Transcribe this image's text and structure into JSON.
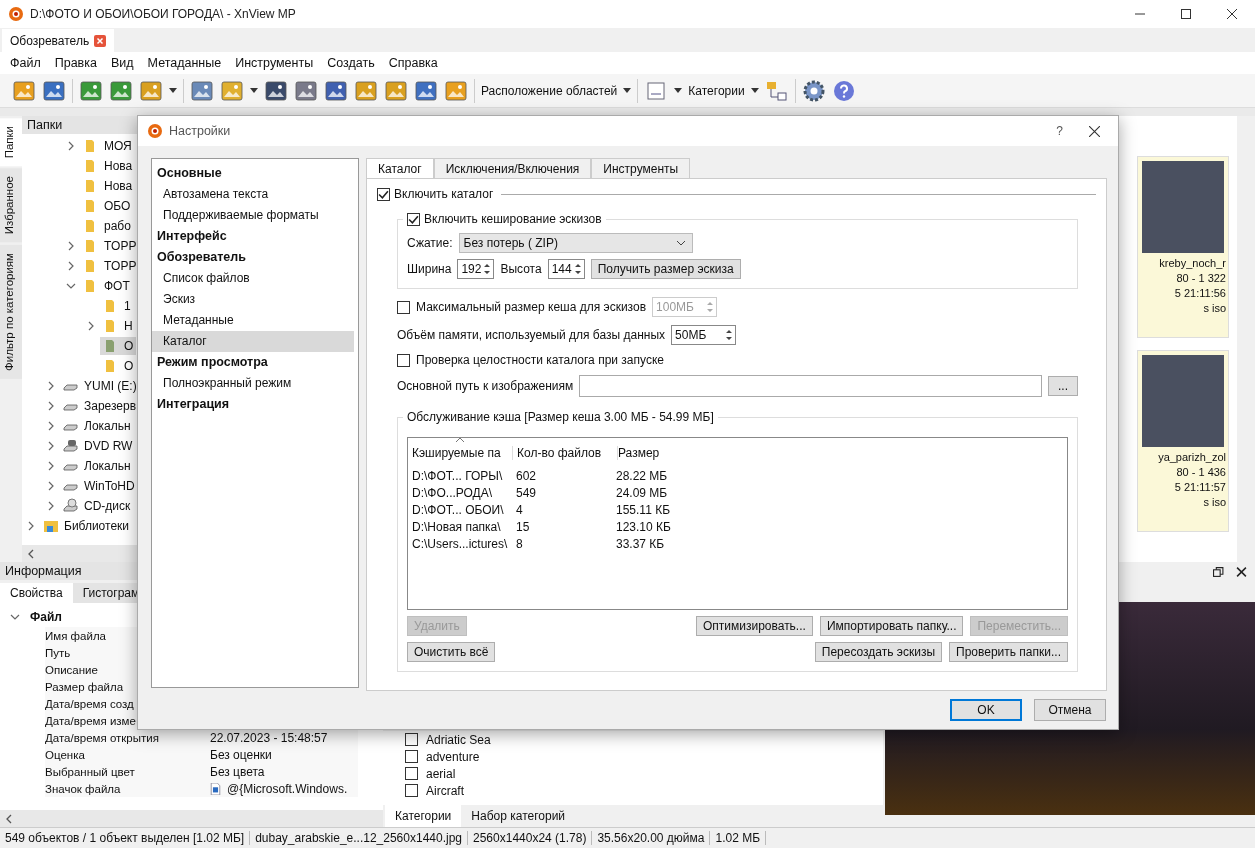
{
  "window": {
    "title": "D:\\ФОТО И ОБОИ\\ОБОИ ГОРОДА\\ - XnView MP"
  },
  "doc_tabs": [
    {
      "label": "Обозреватель",
      "selected": true
    }
  ],
  "menu": [
    "Файл",
    "Правка",
    "Вид",
    "Метаданные",
    "Инструменты",
    "Создать",
    "Справка"
  ],
  "toolbar": {
    "layout_dropdown": "Расположение областей",
    "categories_dropdown": "Категории"
  },
  "side_tabs": [
    {
      "label": "Папки",
      "selected": true
    },
    {
      "label": "Избранное",
      "selected": false
    },
    {
      "label": "Фильтр по категориям",
      "selected": false
    }
  ],
  "folders": {
    "title": "Папки",
    "tree": [
      {
        "children": [
          {
            "children": [
              {
                "label": "МОЯ",
                "kind": "folder",
                "expanded": false,
                "selected": false
              },
              {
                "label": "Нова",
                "kind": "folder",
                "selected": false
              },
              {
                "label": "Нова",
                "kind": "folder",
                "selected": false
              },
              {
                "label": "ОБО",
                "kind": "folder",
                "selected": false
              },
              {
                "label": "рабо",
                "kind": "folder",
                "selected": false
              },
              {
                "label": "TOPP",
                "kind": "folder",
                "expanded": false,
                "selected": false
              },
              {
                "label": "TOPP",
                "kind": "folder",
                "expanded": false,
                "selected": false
              },
              {
                "label": "ФОТ",
                "kind": "folder",
                "expanded": true,
                "selected": false,
                "children": [
                  {
                    "label": "1",
                    "kind": "folder",
                    "selected": false
                  },
                  {
                    "label": "Н",
                    "kind": "folder",
                    "expanded": false,
                    "selected": false
                  },
                  {
                    "label": "О",
                    "kind": "folder",
                    "selected": true
                  },
                  {
                    "label": "О",
                    "kind": "folder",
                    "selected": false
                  }
                ]
              }
            ]
          },
          {
            "label": "YUMI (E:)",
            "kind": "drive",
            "expanded": false,
            "selected": false
          },
          {
            "label": "Зарезерв",
            "kind": "drive",
            "expanded": false,
            "selected": false
          },
          {
            "label": "Локальн",
            "kind": "drive",
            "expanded": false,
            "selected": false
          },
          {
            "label": "DVD RW",
            "kind": "dvd",
            "expanded": false,
            "selected": false
          },
          {
            "label": "Локальн",
            "kind": "drive",
            "expanded": false,
            "selected": false
          },
          {
            "label": "WinToHD",
            "kind": "drive",
            "expanded": false,
            "selected": false
          },
          {
            "label": "CD-диск",
            "kind": "cd",
            "expanded": false,
            "selected": false
          }
        ]
      },
      {
        "label": "Библиотеки",
        "kind": "library",
        "expanded": false,
        "selected": false
      }
    ]
  },
  "thumbnails": [
    {
      "name": "kreby_noch_r",
      "dimensions": "80 - 1 322",
      "date": "5 21:11:56",
      "tag": "s iso"
    },
    {
      "name": "ya_parizh_zol",
      "dimensions": "80 - 1 436",
      "date": "5 21:11:57",
      "tag": "s iso"
    }
  ],
  "info": {
    "title": "Информация",
    "tabs": [
      {
        "label": "Свойства",
        "selected": true
      },
      {
        "label": "Гистограм",
        "selected": false
      }
    ],
    "section": {
      "label": "Файл",
      "expanded": true,
      "rows": [
        {
          "name": "Имя файла"
        },
        {
          "name": "Путь"
        },
        {
          "name": "Описание"
        },
        {
          "name": "Размер файла"
        },
        {
          "name": "Дата/время созд"
        },
        {
          "name": "Дата/время изме"
        },
        {
          "name": "Дата/время открытия",
          "value": "22.07.2023 - 15:48:57"
        },
        {
          "name": "Оценка",
          "value": "Без оценки"
        },
        {
          "name": "Выбранный цвет",
          "value": "Без цвета"
        },
        {
          "name": "Значок файла",
          "value": "@{Microsoft.Windows.",
          "kind": "icon"
        }
      ]
    }
  },
  "categories": {
    "items": [
      {
        "label": "Adriatic Sea",
        "checked": false
      },
      {
        "label": "adventure",
        "checked": false
      },
      {
        "label": "aerial",
        "checked": false
      },
      {
        "label": "Aircraft",
        "checked": false
      }
    ],
    "tabs": [
      {
        "label": "Категории",
        "selected": true
      },
      {
        "label": "Набор категорий",
        "selected": false
      }
    ]
  },
  "status_bar": [
    "549 объектов / 1 объект выделен [1.02 МБ]",
    "dubay_arabskie_e...12_2560x1440.jpg",
    "2560x1440x24 (1.78)",
    "35.56x20.00 дюйма",
    "1.02 МБ"
  ],
  "dialog": {
    "title": "Настройки",
    "help": "?",
    "nav": [
      {
        "label": "Основные",
        "kind": "section",
        "selected": false
      },
      {
        "label": "Автозамена текста",
        "kind": "page",
        "selected": false
      },
      {
        "label": "Поддерживаемые форматы",
        "kind": "page",
        "selected": false
      },
      {
        "label": "Интерфейс",
        "kind": "section",
        "selected": false
      },
      {
        "label": "Обозреватель",
        "kind": "section",
        "selected": false
      },
      {
        "label": "Список файлов",
        "kind": "page",
        "selected": false
      },
      {
        "label": "Эскиз",
        "kind": "page",
        "selected": false
      },
      {
        "label": "Метаданные",
        "kind": "page",
        "selected": false
      },
      {
        "label": "Каталог",
        "kind": "page",
        "selected": true
      },
      {
        "label": "Режим просмотра",
        "kind": "section",
        "selected": false
      },
      {
        "label": "Полноэкранный режим",
        "kind": "page",
        "selected": false
      },
      {
        "label": "Интеграция",
        "kind": "section",
        "selected": false
      }
    ],
    "tabs": [
      {
        "label": "Каталог",
        "selected": true
      },
      {
        "label": "Исключения/Включения",
        "selected": false
      },
      {
        "label": "Инструменты",
        "selected": false
      }
    ],
    "enable_catalog": {
      "label": "Включить каталог",
      "checked": true
    },
    "thumb_cache": {
      "label": "Включить кеширование эскизов",
      "checked": true,
      "compression_label": "Сжатие:",
      "compression_value": "Без потерь ( ZIP)",
      "width_label": "Ширина",
      "width_value": "192",
      "height_label": "Высота",
      "height_value": "144",
      "get_size_button": "Получить размер эскиза"
    },
    "max_cache": {
      "label": "Максимальный размер кеша для эскизов",
      "checked": false,
      "value": "100МБ",
      "disabled": true
    },
    "db_memory": {
      "label": "Объём памяти, используемый для базы данных",
      "value": "50МБ"
    },
    "integrity_check": {
      "label": "Проверка целостности каталога при запуске",
      "checked": false
    },
    "base_path": {
      "label": "Основной путь к изображениям",
      "browse_button": "..."
    },
    "cache_maintenance": {
      "title": "Обслуживание кэша [Размер кеша 3.00 МБ - 54.99 МБ]",
      "columns": [
        "Кэшируемые па",
        "Кол-во файлов",
        "Размер"
      ],
      "rows": [
        [
          "D:\\ФОТ... ГОРЫ\\",
          "602",
          "28.22 МБ"
        ],
        [
          "D:\\ФО...РОДА\\",
          "549",
          "24.09 МБ"
        ],
        [
          "D:\\ФОТ... ОБОИ\\",
          "4",
          "155.11 КБ"
        ],
        [
          "D:\\Новая папка\\",
          "15",
          "123.10 КБ"
        ],
        [
          "C:\\Users...ictures\\",
          "8",
          "33.37 КБ"
        ]
      ],
      "button_rows": [
        {
          "left": [
            {
              "label": "Удалить",
              "disabled": true
            }
          ],
          "right": [
            {
              "label": "Оптимизировать...",
              "disabled": false
            },
            {
              "label": "Импортировать папку...",
              "disabled": false
            },
            {
              "label": "Переместить...",
              "disabled": true
            }
          ]
        },
        {
          "left": [
            {
              "label": "Очистить всё",
              "disabled": false
            }
          ],
          "right": [
            {
              "label": "Пересоздать эскизы",
              "disabled": false
            },
            {
              "label": "Проверить папки...",
              "disabled": false
            }
          ]
        }
      ]
    },
    "buttons": [
      {
        "label": "OK",
        "default": true
      },
      {
        "label": "Отмена",
        "default": false
      }
    ]
  }
}
